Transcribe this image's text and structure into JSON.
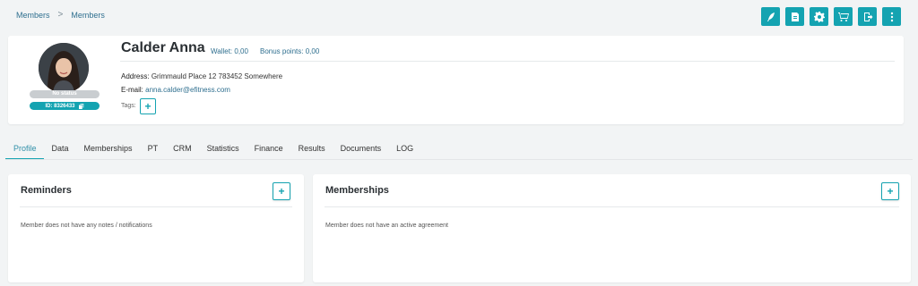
{
  "breadcrumb": {
    "items": [
      "Members",
      "Members"
    ],
    "separator": ">"
  },
  "actions": [
    {
      "icon": "feather-icon",
      "label": ""
    },
    {
      "icon": "document-icon",
      "label": ""
    },
    {
      "icon": "gear-icon",
      "label": ""
    },
    {
      "icon": "cart-icon",
      "label": ""
    },
    {
      "icon": "exit-icon",
      "label": ""
    },
    {
      "icon": "more-vertical-icon",
      "label": ""
    }
  ],
  "member": {
    "name": "Calder Anna",
    "wallet": "Wallet: 0,00",
    "bonus": "Bonus points: 0,00",
    "status": "No status",
    "id": "ID: 8326433",
    "address_label": "Address:",
    "address": "Grimmauld Place 12 783452 Somewhere",
    "email_label": "E-mail:",
    "email": "anna.calder@efitness.com",
    "tags_label": "Tags:",
    "tag_add": "+"
  },
  "tabs": [
    "Profile",
    "Data",
    "Memberships",
    "PT",
    "CRM",
    "Statistics",
    "Finance",
    "Results",
    "Documents",
    "LOG"
  ],
  "active_tab": "Profile",
  "reminders": {
    "title": "Reminders",
    "add": "+",
    "empty": "Member does not have any notes / notifications"
  },
  "memberships": {
    "title": "Memberships",
    "add": "+",
    "empty": "Member does not have an active agreement"
  },
  "colors": {
    "accent": "#14a3b1",
    "link": "#2f6f8f",
    "background": "#f2f4f5"
  }
}
